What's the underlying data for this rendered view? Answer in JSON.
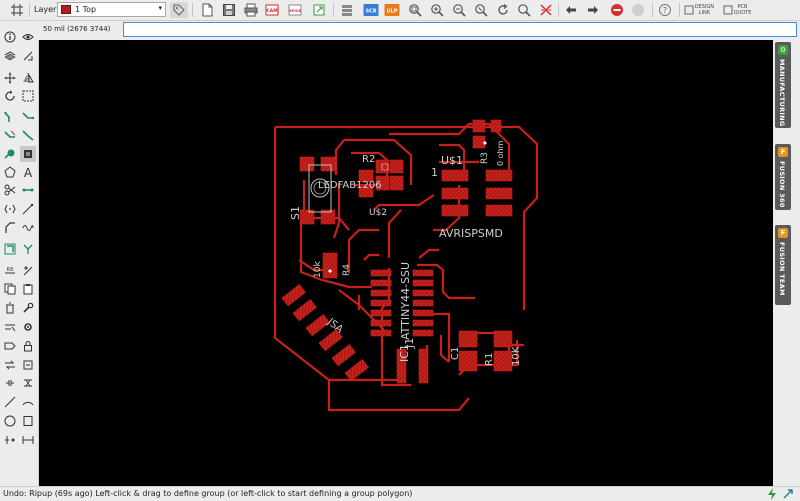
{
  "toolbar": {
    "layer_label": "Layer:",
    "layer_value": "1 Top",
    "layer_color": "#b02020",
    "button_text": {
      "scr": "SCR",
      "ulp": "ULP",
      "spice": "SPICE",
      "design_link_1": "DESIGN",
      "design_link_2": "LINK",
      "pcb_quote_1": "PCB",
      "pcb_quote_2": "QUOTE"
    }
  },
  "command": {
    "coordinate": "50 mil (2676 3744)",
    "input_value": "",
    "input_placeholder": ""
  },
  "right_panel": {
    "tabs": [
      {
        "label": "MANUFACTURING",
        "icon": "manufacturing-icon",
        "color": "#3aa13a"
      },
      {
        "label": "FUSION 360",
        "icon": "fusion-icon",
        "color": "#e8941a"
      },
      {
        "label": "FUSION TEAM",
        "icon": "fusion-team-icon",
        "color": "#e8941a"
      }
    ]
  },
  "board": {
    "trace_color": "#c8201a",
    "label_color": "#d0d0d0",
    "labels": {
      "r2": "R2",
      "us1": "U$1",
      "one": "1",
      "r3": "R3",
      "ohm": "0 ohm",
      "led": "LEDFAB1206",
      "us2": "U$2",
      "s1": "S1",
      "avr": "AVRISPSMD",
      "attiny": "ATTINY44-SSU",
      "r4": "R4",
      "tenk1": "10k",
      "j1": "J1",
      "ic1": "IC1",
      "c1": "C1",
      "r1": "R1",
      "tenk2": "10K",
      "jsa": "JSA"
    }
  },
  "status": {
    "text": "Undo: Ripup (69s ago) Left-click & drag to define group (or left-click to start defining a group polygon)"
  }
}
